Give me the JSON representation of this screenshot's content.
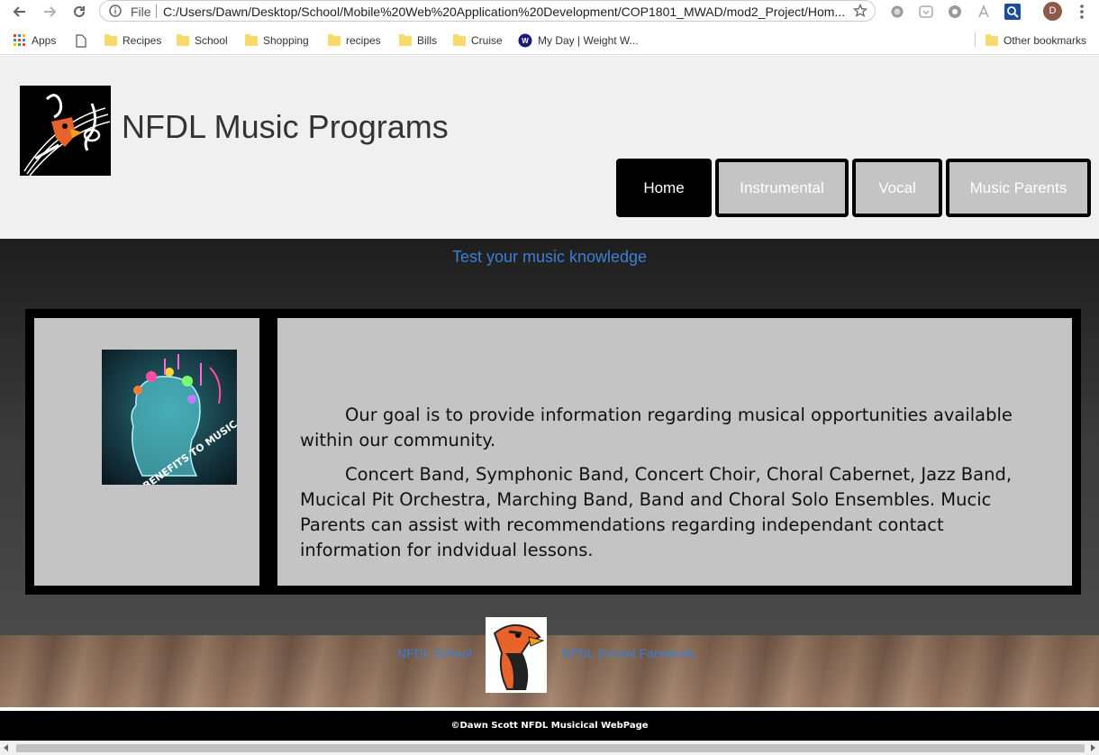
{
  "browser": {
    "url_scheme": "File",
    "url": "C:/Users/Dawn/Desktop/School/Mobile%20Web%20Application%20Development/COP1801_MWAD/mod2_Project/Hom...",
    "profile_initial": "D",
    "bookmarks": [
      {
        "label": "Apps",
        "icon": "apps-grid-icon"
      },
      {
        "label": "",
        "icon": "page-icon"
      },
      {
        "label": "Recipes",
        "icon": "folder-icon"
      },
      {
        "label": "School",
        "icon": "folder-icon"
      },
      {
        "label": "Shopping",
        "icon": "folder-icon"
      },
      {
        "label": "recipes",
        "icon": "folder-icon"
      },
      {
        "label": "Bills",
        "icon": "folder-icon"
      },
      {
        "label": "Cruise",
        "icon": "folder-icon"
      },
      {
        "label": "My Day | Weight W...",
        "icon": "ww-icon"
      }
    ],
    "other_bookmarks": "Other bookmarks"
  },
  "site": {
    "title": "NFDL Music Programs",
    "nav": [
      {
        "label": "Home",
        "active": true
      },
      {
        "label": "Instrumental",
        "active": false
      },
      {
        "label": "Vocal",
        "active": false
      },
      {
        "label": "Music Parents",
        "active": false
      }
    ],
    "quiz_link": "Test your music knowledge",
    "image_caption": "BENEFITS TO MUSIC",
    "paragraphs": [
      "Our goal is to provide information regarding musical opportunities available within our community.",
      "Concert Band, Symphonic Band, Concert Choir, Choral Cabernet, Jazz Band, Mucical Pit Orchestra, Marching Band, Band and Choral Solo Ensembles. Mucic Parents can assist with recommendations regarding independant contact information for indvidual lessons."
    ],
    "footer_links": [
      "NFDL School",
      "NFDL School Facebook"
    ],
    "copyright": "©Dawn Scott NFDL Musicical WebPage"
  },
  "colors": {
    "link": "#3c7fd4",
    "nav_active": "#000000",
    "nav_inactive": "#c4c4c4",
    "panel": "#c4c4c4",
    "header_bg": "#f0f0f0"
  }
}
